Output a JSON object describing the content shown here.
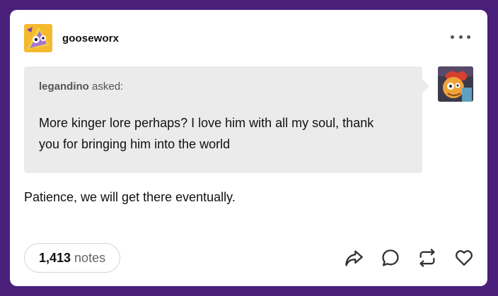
{
  "post": {
    "blog_name": "gooseworx",
    "ask": {
      "asker": "legandino",
      "asked_label": "asked:",
      "question": "More kinger lore perhaps? I love him with all my soul, thank you for bringing him into the world"
    },
    "answer": "Patience, we will get there eventually.",
    "notes_count": "1,413",
    "notes_label": "notes"
  },
  "icons": {
    "more": "more-menu-icon",
    "share": "share-icon",
    "reply": "reply-icon",
    "reblog": "reblog-icon",
    "like": "heart-icon"
  },
  "colors": {
    "background": "#4a1f7a",
    "card": "#ffffff",
    "ask_box": "#ebebeb"
  }
}
